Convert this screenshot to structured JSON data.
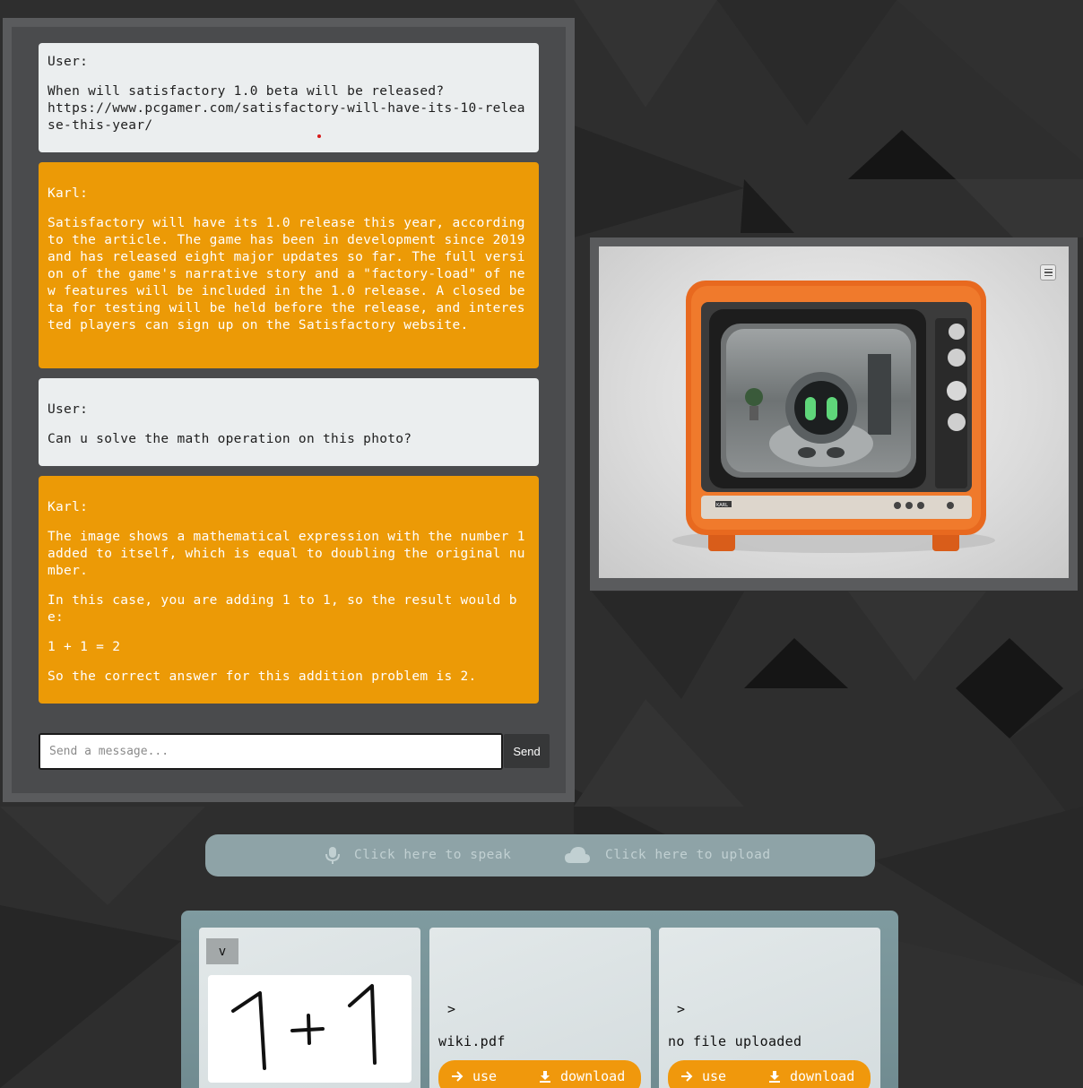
{
  "chat": {
    "messages": [
      {
        "role": "user",
        "speaker": "User:",
        "paragraphs": [
          "When will satisfactory 1.0 beta will be released?\nhttps://www.pcgamer.com/satisfactory-will-have-its-10-release-this-year/"
        ]
      },
      {
        "role": "bot",
        "speaker": "Karl:",
        "paragraphs": [
          "Satisfactory will have its 1.0 release this year, according to the article. The game has been in development since 2019 and has released eight major updates so far. The full version of the game's narrative story and a \"factory-load\" of new features will be included in the 1.0 release. A closed beta for testing will be held before the release, and interested players can sign up on the Satisfactory website."
        ]
      },
      {
        "role": "user",
        "speaker": "User:",
        "paragraphs": [
          "Can u solve the math operation on this photo?"
        ]
      },
      {
        "role": "bot",
        "speaker": "Karl:",
        "paragraphs": [
          "The image shows a mathematical expression with the number 1 added to itself, which is equal to doubling the original number.",
          "In this case, you are adding 1 to 1, so the result would be:",
          "1 + 1 = 2",
          "So the correct answer for this addition problem is 2."
        ]
      }
    ],
    "input_placeholder": "Send a message...",
    "send_label": "Send"
  },
  "tv": {
    "badge": "KARL",
    "menu_icon": "menu-icon"
  },
  "voice": {
    "speak_label": "Click here to speak",
    "upload_label": "Click here to upload",
    "speak_icon": "microphone-icon",
    "upload_icon": "cloud-icon"
  },
  "files": {
    "cards": [
      {
        "toggle": "v",
        "preview": "1 + 1"
      },
      {
        "toggle": ">",
        "name": "wiki.pdf",
        "use_label": "use",
        "download_label": "download"
      },
      {
        "toggle": ">",
        "name": "no file uploaded",
        "use_label": "use",
        "download_label": "download"
      }
    ]
  },
  "colors": {
    "accent": "#ec9a06",
    "user_bubble": "#ebeeef",
    "panel": "#4a4b4d",
    "voice_bar": "#8ea3a7"
  }
}
